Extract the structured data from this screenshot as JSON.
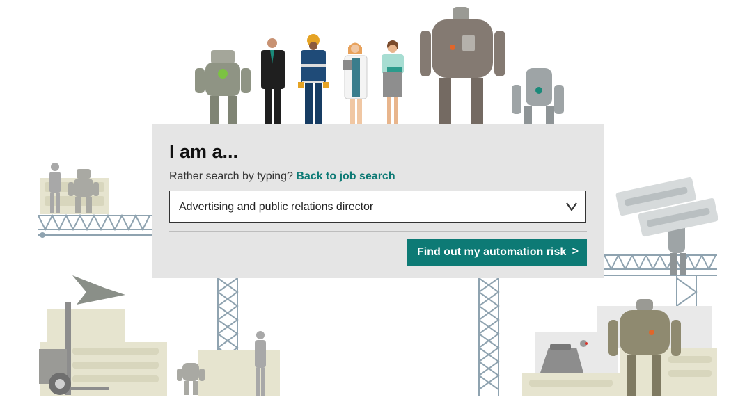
{
  "heading": "I am a...",
  "search_prompt": "Rather search by typing?",
  "search_link": "Back to job search",
  "job_select": {
    "selected": "Advertising and public relations director",
    "chevron_icon": "chevron-down-icon"
  },
  "submit_button": {
    "label": "Find out my automation risk",
    "arrow": ">"
  },
  "colors": {
    "accent": "#0d7a75",
    "panel": "#e5e5e5",
    "robot": "#8a8a80",
    "scaffold": "#8fa3b0",
    "crate": "#e6e4cf"
  }
}
